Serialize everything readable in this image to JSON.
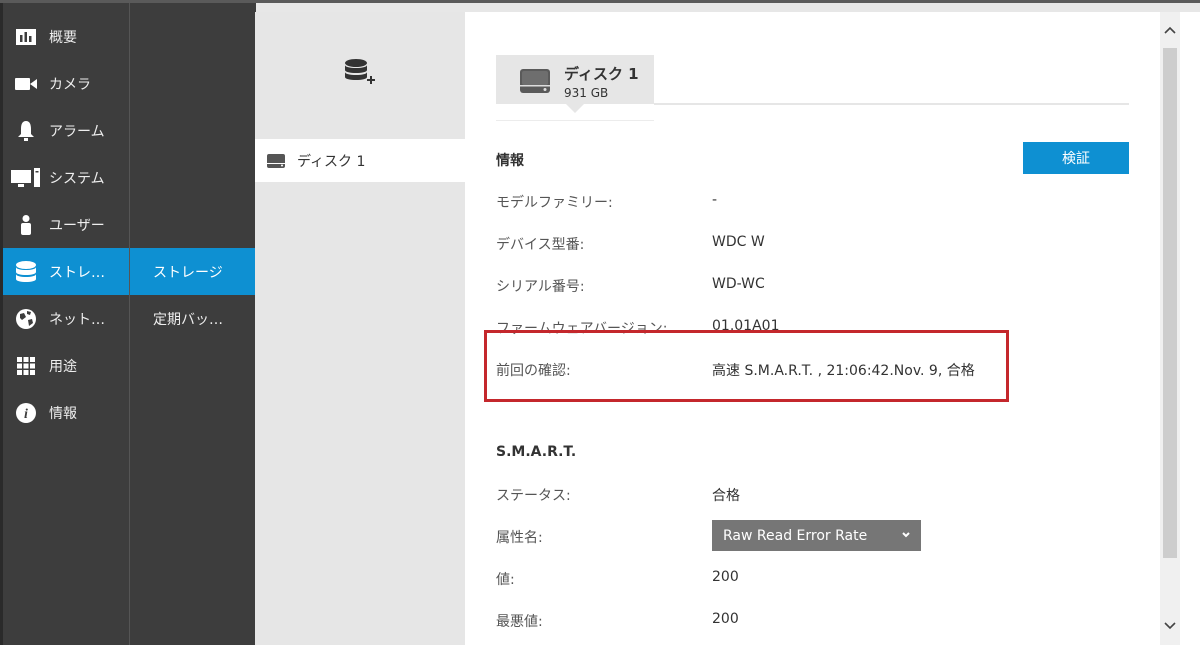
{
  "nav": {
    "items": [
      {
        "label": "概要",
        "icon": "overview-icon"
      },
      {
        "label": "カメラ",
        "icon": "camera-icon"
      },
      {
        "label": "アラーム",
        "icon": "bell-icon"
      },
      {
        "label": "システム",
        "icon": "monitor-icon"
      },
      {
        "label": "ユーザー",
        "icon": "user-icon"
      },
      {
        "label": "ストレ…",
        "icon": "database-icon",
        "active": true
      },
      {
        "label": "ネット…",
        "icon": "globe-icon"
      },
      {
        "label": "用途",
        "icon": "grid-icon"
      },
      {
        "label": "情報",
        "icon": "info-icon"
      }
    ]
  },
  "subnav": {
    "items": [
      {
        "label": "ストレージ",
        "active": true
      },
      {
        "label": "定期バッ…"
      }
    ]
  },
  "disk_list": {
    "items": [
      {
        "label": "ディスク 1"
      }
    ]
  },
  "tab": {
    "title": "ディスク 1",
    "size": "931 GB"
  },
  "info": {
    "title": "情報",
    "verify_label": "検証",
    "rows": [
      {
        "label": "モデルファミリー:",
        "value": "-"
      },
      {
        "label": "デバイス型番:",
        "value": "WDC W"
      },
      {
        "label": "シリアル番号:",
        "value": "WD-WC"
      },
      {
        "label": "ファームウェアバージョン:",
        "value": "01.01A01"
      },
      {
        "label": "前回の確認:",
        "value": "高速 S.M.A.R.T. , 21:06:42.Nov. 9, 合格"
      }
    ]
  },
  "smart": {
    "title": "S.M.A.R.T.",
    "status_label": "ステータス:",
    "status_value": "合格",
    "attribute_label": "属性名:",
    "attribute_selected": "Raw Read Error Rate",
    "value_label": "値:",
    "value_value": "200",
    "worst_label": "最悪値:",
    "worst_value": "200"
  },
  "colors": {
    "accent": "#0e90d2",
    "nav_bg": "#3d3d3d",
    "highlight": "#c4272c"
  }
}
